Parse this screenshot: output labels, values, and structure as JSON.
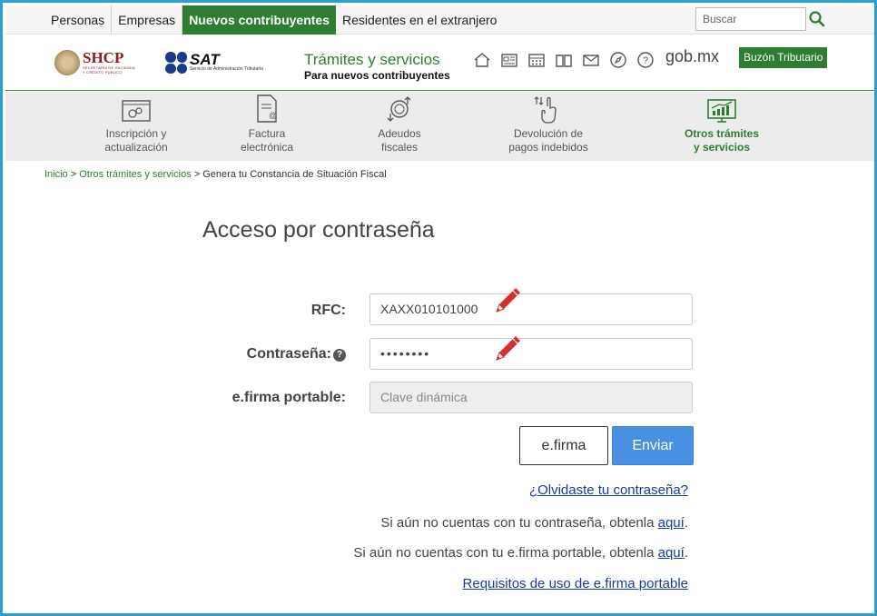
{
  "topnav": {
    "items": [
      {
        "label": "Personas"
      },
      {
        "label": "Empresas"
      },
      {
        "label": "Nuevos contribuyentes",
        "active": true
      },
      {
        "label": "Residentes en el extranjero"
      }
    ],
    "search_placeholder": "Buscar",
    "search_icon": "search-icon"
  },
  "header": {
    "shcp": {
      "name": "SHCP",
      "subtitle1": "SECRETARÍA DE HACIENDA",
      "subtitle2": "Y CRÉDITO PÚBLICO"
    },
    "sat": {
      "name": "SAT",
      "subtitle": "Servicio de Administración Tributaria"
    },
    "tramites_title": "Trámites y servicios",
    "tramites_subtitle": "Para nuevos contribuyentes",
    "icons": [
      "home-icon",
      "newspaper-icon",
      "calendar-icon",
      "book-icon",
      "mail-icon",
      "compass-icon",
      "help-icon"
    ],
    "gobmx": "gob.mx",
    "buzon": "Buzón Tributario"
  },
  "categories": [
    {
      "line1": "Inscripción y",
      "line2": "actualización",
      "icon": "registration-icon"
    },
    {
      "line1": "Factura",
      "line2": "electrónica",
      "icon": "invoice-icon"
    },
    {
      "line1": "Adeudos",
      "line2": "fiscales",
      "icon": "debts-icon"
    },
    {
      "line1": "Devolución de",
      "line2": "pagos indebidos",
      "icon": "refund-icon"
    },
    {
      "line1": "Otros trámites",
      "line2": "y servicios",
      "icon": "other-services-icon",
      "active": true
    }
  ],
  "breadcrumb": {
    "home": "Inicio",
    "sep1": " > ",
    "section": "Otros trámites y servicios",
    "sep2": " > ",
    "current": "Genera tu Constancia de Situación Fiscal"
  },
  "form": {
    "title": "Acceso por contraseña",
    "rfc_label": "RFC:",
    "rfc_value": "XAXX010101000",
    "password_label": "Contraseña:",
    "password_help": "?",
    "password_value": "••••••••",
    "efirma_label": "e.firma portable:",
    "efirma_placeholder": "Clave dinámica",
    "btn_efirma": "e.firma",
    "btn_enviar": "Enviar"
  },
  "links": {
    "forgot": "¿Olvidaste tu contraseña?",
    "no_password_text": "Si aún no cuentas con tu contraseña, obtenla ",
    "no_password_link": "aquí",
    "no_efirma_text": "Si aún no cuentas con tu e.firma portable, obtenla ",
    "no_efirma_link": "aquí",
    "period": ".",
    "requisitos": "Requisitos de uso de e.firma portable"
  },
  "colors": {
    "green": "#2e7d32",
    "blue_button": "#4a90e2",
    "link": "#1a3ca0",
    "annotation_red": "#d32f2f",
    "frame": "#2aa0d0"
  }
}
